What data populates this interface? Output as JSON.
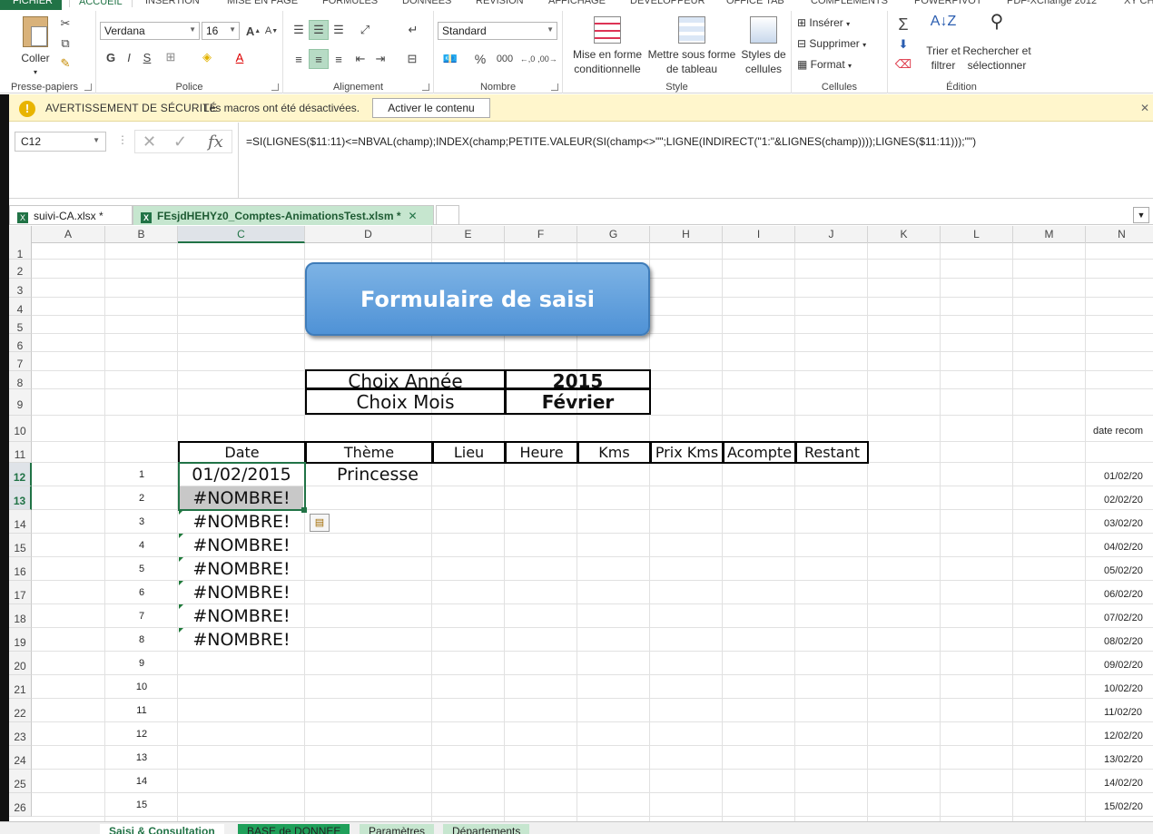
{
  "ribbon_tabs": [
    "FICHIER",
    "ACCUEIL",
    "INSERTION",
    "MISE EN PAGE",
    "FORMULES",
    "DONNÉES",
    "RÉVISION",
    "AFFICHAGE",
    "DÉVELOPPEUR",
    "OFFICE TAB",
    "COMPLÉMENTS",
    "POWERPIVOT",
    "PDF-XChange 2012",
    "XY CH"
  ],
  "ribbon": {
    "clipboard": {
      "paste": "Coller",
      "label": "Presse-papiers"
    },
    "font": {
      "name": "Verdana",
      "size": "16",
      "bold": "G",
      "italic": "I",
      "underline": "S",
      "label": "Police"
    },
    "alignment": {
      "label": "Alignement"
    },
    "number": {
      "format": "Standard",
      "label": "Nombre",
      "percent": "%",
      "thousands": "000"
    },
    "styles": {
      "cond": "Mise en forme conditionnelle",
      "table": "Mettre sous forme de tableau",
      "cell": "Styles de cellules",
      "label": "Style"
    },
    "cells": {
      "insert": "Insérer",
      "delete": "Supprimer",
      "format": "Format",
      "label": "Cellules"
    },
    "editing": {
      "sort": "Trier et filtrer",
      "find": "Rechercher et sélectionner",
      "label": "Édition"
    }
  },
  "security": {
    "title": "AVERTISSEMENT DE SÉCURITÉ",
    "message": "Les macros ont été désactivées.",
    "button": "Activer le contenu"
  },
  "formula_bar": {
    "name_box": "C12",
    "formula": "=SI(LIGNES($11:11)<=NBVAL(champ);INDEX(champ;PETITE.VALEUR(SI(champ<>\"\";LIGNE(INDIRECT(\"1:\"&LIGNES(champ))));LIGNES($11:11)));\"\")"
  },
  "workbook_tabs": [
    {
      "label": "suivi-CA.xlsx *"
    },
    {
      "label": "FEsjdHEHYz0_Comptes-AnimationsTest.xlsm *"
    }
  ],
  "columns": [
    "A",
    "B",
    "C",
    "D",
    "E",
    "F",
    "G",
    "H",
    "I",
    "J",
    "K",
    "L",
    "M",
    "N"
  ],
  "rows": [
    "1",
    "2",
    "3",
    "4",
    "5",
    "6",
    "7",
    "8",
    "9",
    "10",
    "11",
    "12",
    "13",
    "14",
    "15",
    "16",
    "17",
    "18",
    "19",
    "20",
    "21",
    "22",
    "23",
    "24",
    "25",
    "26"
  ],
  "sheet": {
    "form_button": "Formulaire de saisi",
    "choice": [
      {
        "label": "Choix Année",
        "value": "2015"
      },
      {
        "label": "Choix Mois",
        "value": "Février"
      }
    ],
    "table_headers": [
      "Date",
      "Thème",
      "Lieu",
      "Heure",
      "Kms",
      "Prix Kms",
      "Acompte",
      "Restant"
    ],
    "index_values": [
      "1",
      "2",
      "3",
      "4",
      "5",
      "6",
      "7",
      "8",
      "9",
      "10",
      "11",
      "12",
      "13",
      "14",
      "15"
    ],
    "date_values": [
      "01/02/2015",
      "#NOMBRE!",
      "#NOMBRE!",
      "#NOMBRE!",
      "#NOMBRE!",
      "#NOMBRE!",
      "#NOMBRE!",
      "#NOMBRE!"
    ],
    "theme_first": "Princesse",
    "side_header": "date recom",
    "side_dates": [
      "01/02/20",
      "02/02/20",
      "03/02/20",
      "04/02/20",
      "05/02/20",
      "06/02/20",
      "07/02/20",
      "08/02/20",
      "09/02/20",
      "10/02/20",
      "11/02/20",
      "12/02/20",
      "13/02/20",
      "14/02/20",
      "15/02/20"
    ]
  },
  "sheet_tabs": [
    "Saisi & Consultation",
    "BASE de DONNEE",
    "Paramètres",
    "Départements"
  ]
}
